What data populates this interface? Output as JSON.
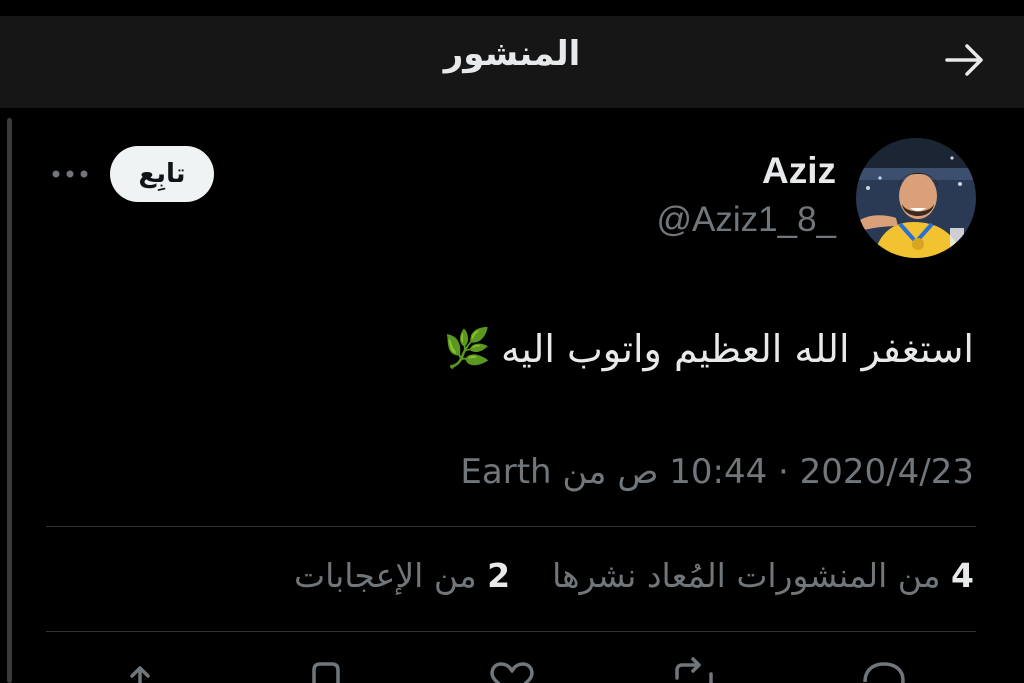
{
  "header": {
    "title": "المنشور",
    "back_icon": "arrow-right-icon"
  },
  "tweet": {
    "author": {
      "display_name": "Aziz",
      "handle": "@Aziz1_8_",
      "avatar": "avatar-photo"
    },
    "follow_label": "تابِع",
    "more_icon": "more-horizontal-icon",
    "text": "استغفر الله العظيم واتوب اليه",
    "emoji": "🌿",
    "meta": {
      "date": "2020/4/23",
      "separator": "·",
      "time": "10:44 ص",
      "from_label": "من",
      "source": "Earth"
    },
    "stats": {
      "reposts_count": "4",
      "reposts_label": "من المنشورات المُعاد نشرها",
      "likes_count": "2",
      "likes_label": "من الإعجابات"
    }
  },
  "actions": [
    {
      "name": "reply-icon"
    },
    {
      "name": "repost-icon"
    },
    {
      "name": "like-icon"
    },
    {
      "name": "bookmark-icon"
    },
    {
      "name": "share-icon"
    }
  ],
  "colors": {
    "background": "#000000",
    "header_bg": "#161616",
    "primary_text": "#e7e9ea",
    "secondary_text": "#71767b",
    "divider": "#2f3336",
    "follow_bg": "#eff3f4"
  }
}
